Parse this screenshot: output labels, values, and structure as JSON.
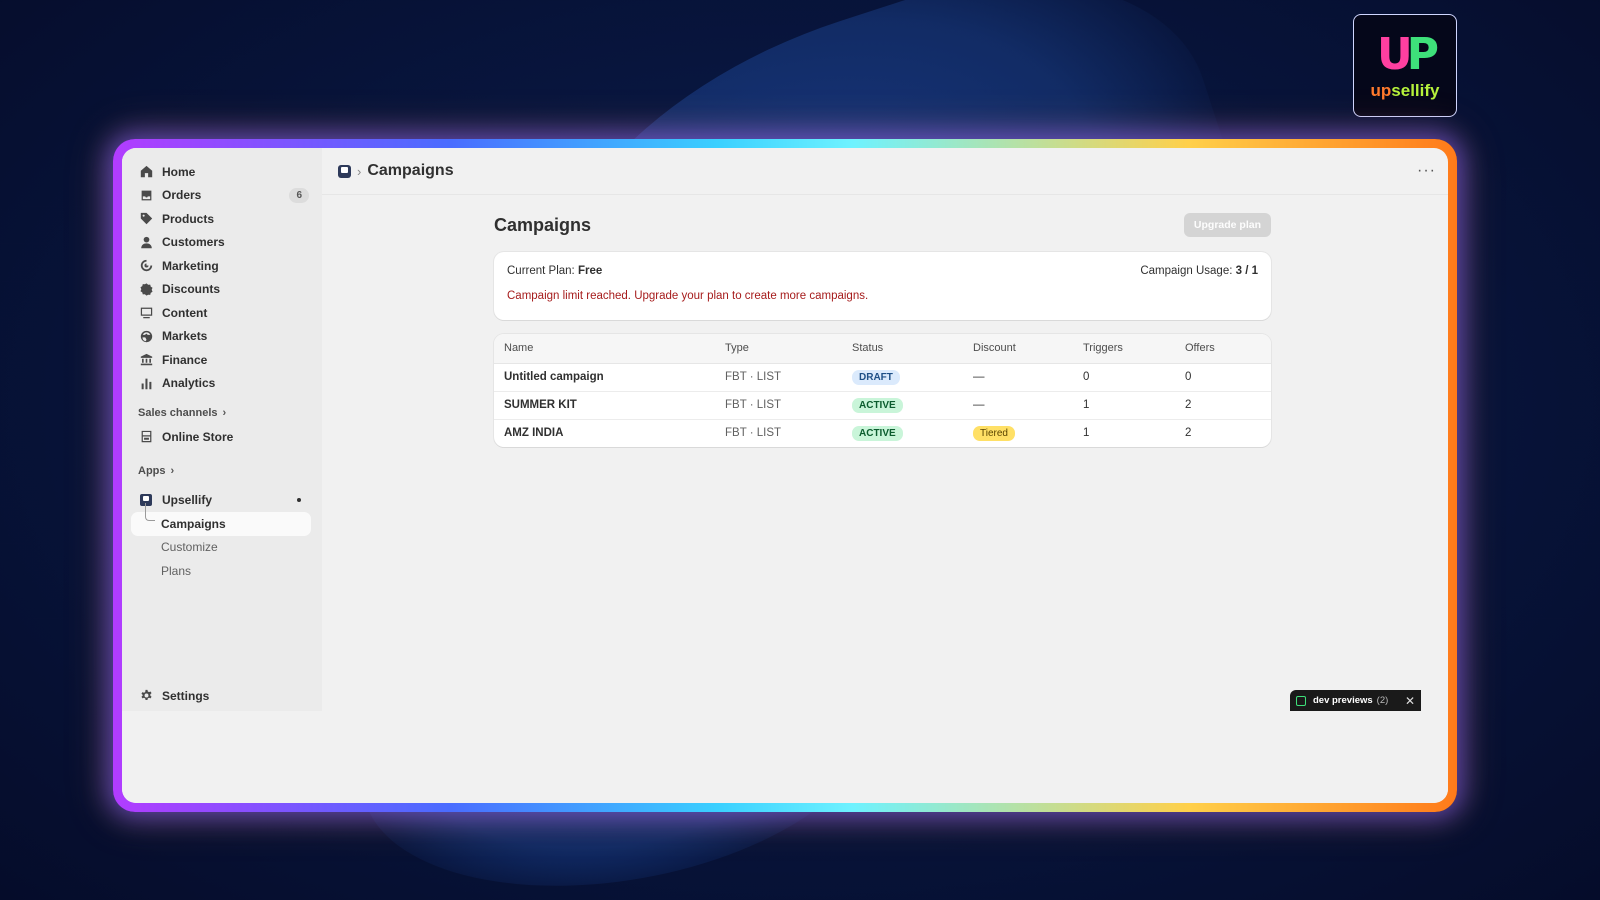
{
  "logo": {
    "text_a": "up",
    "text_b": "sellify",
    "mark_u": "U",
    "mark_p": "P"
  },
  "sidebar": {
    "items": [
      {
        "label": "Home",
        "icon": "home-icon"
      },
      {
        "label": "Orders",
        "icon": "inbox-icon",
        "badge": "6"
      },
      {
        "label": "Products",
        "icon": "tag-icon"
      },
      {
        "label": "Customers",
        "icon": "person-icon"
      },
      {
        "label": "Marketing",
        "icon": "target-icon"
      },
      {
        "label": "Discounts",
        "icon": "discount-icon"
      },
      {
        "label": "Content",
        "icon": "content-icon"
      },
      {
        "label": "Markets",
        "icon": "globe-icon"
      },
      {
        "label": "Finance",
        "icon": "bank-icon"
      },
      {
        "label": "Analytics",
        "icon": "bar-chart-icon"
      }
    ],
    "sales_channels_label": "Sales channels",
    "online_store_label": "Online Store",
    "apps_label": "Apps",
    "app_name": "Upsellify",
    "app_sub_items": [
      {
        "label": "Campaigns",
        "active": true
      },
      {
        "label": "Customize",
        "active": false
      },
      {
        "label": "Plans",
        "active": false
      }
    ],
    "settings_label": "Settings"
  },
  "topbar": {
    "title": "Campaigns",
    "more": "···"
  },
  "main": {
    "title": "Campaigns",
    "upgrade_label": "Upgrade plan",
    "plan_prefix": "Current Plan: ",
    "plan_value": "Free",
    "usage_prefix": "Campaign Usage: ",
    "usage_value": "3 / 1",
    "warning": "Campaign limit reached. Upgrade your plan to create more campaigns.",
    "columns": [
      "Name",
      "Type",
      "Status",
      "Discount",
      "Triggers",
      "Offers"
    ],
    "rows": [
      {
        "name": "Untitled campaign",
        "type": "FBT · LIST",
        "status": "DRAFT",
        "discount": "—",
        "triggers": "0",
        "offers": "0"
      },
      {
        "name": "SUMMER KIT",
        "type": "FBT · LIST",
        "status": "ACTIVE",
        "discount": "—",
        "triggers": "1",
        "offers": "2"
      },
      {
        "name": "AMZ INDIA",
        "type": "FBT · LIST",
        "status": "ACTIVE",
        "discount": "Tiered",
        "triggers": "1",
        "offers": "2"
      }
    ]
  },
  "dev_bar": {
    "label": "dev previews",
    "count": "(2)",
    "close": "✕"
  }
}
